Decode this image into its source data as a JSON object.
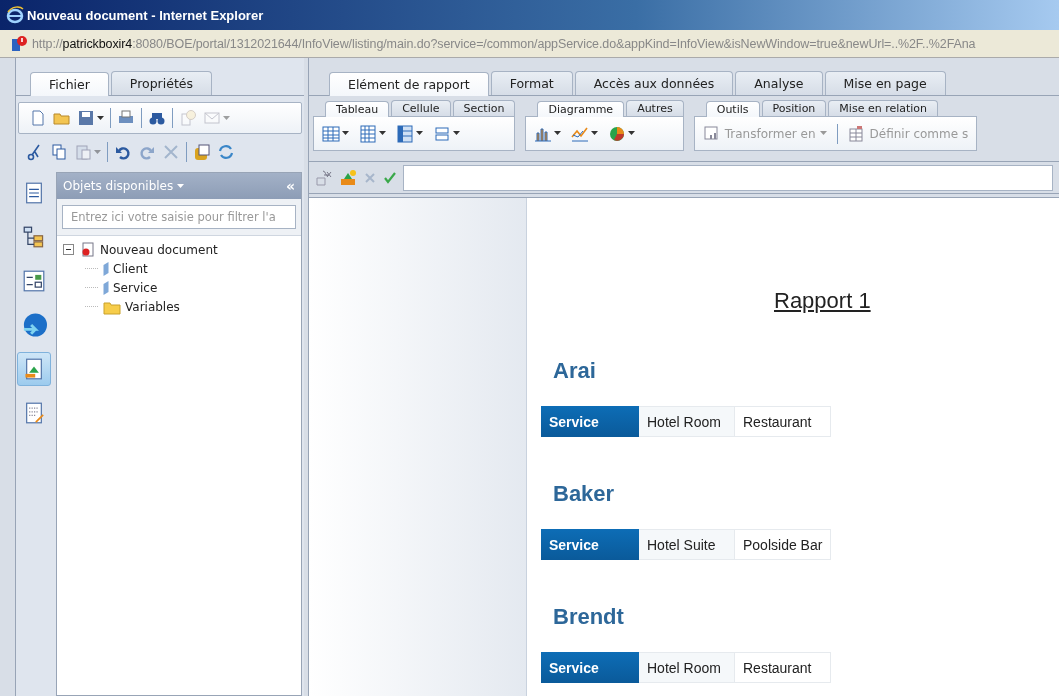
{
  "window": {
    "title": "Nouveau document - Internet Explorer"
  },
  "address": {
    "scheme": "http://",
    "host": "patrickboxir4",
    "rest": ":8080/BOE/portal/1312021644/InfoView/listing/main.do?service=/common/appService.do&appKind=InfoView&isNewWindow=true&newUrl=..%2F..%2FAna"
  },
  "left_tabs": [
    {
      "label": "Fichier",
      "selected": true
    },
    {
      "label": "Propriétés",
      "selected": false
    }
  ],
  "toolbar_1": [
    {
      "kind": "button",
      "disabled": false,
      "dropdown": false
    },
    {
      "kind": "button",
      "disabled": false,
      "dropdown": false
    },
    {
      "kind": "button",
      "disabled": false,
      "dropdown": true
    },
    {
      "kind": "separator"
    },
    {
      "kind": "button",
      "disabled": false,
      "dropdown": false
    },
    {
      "kind": "separator"
    },
    {
      "kind": "button",
      "disabled": false,
      "dropdown": false
    },
    {
      "kind": "separator"
    },
    {
      "kind": "button",
      "disabled": true,
      "dropdown": false
    },
    {
      "kind": "button",
      "disabled": true,
      "dropdown": true
    }
  ],
  "toolbar_2": [
    {
      "kind": "button",
      "disabled": false,
      "dropdown": false
    },
    {
      "kind": "button",
      "disabled": false,
      "dropdown": false
    },
    {
      "kind": "button",
      "disabled": true,
      "dropdown": true
    },
    {
      "kind": "separator"
    },
    {
      "kind": "button",
      "disabled": false,
      "dropdown": false
    },
    {
      "kind": "button",
      "disabled": true,
      "dropdown": false
    },
    {
      "kind": "button",
      "disabled": true,
      "dropdown": false
    },
    {
      "kind": "separator"
    },
    {
      "kind": "button",
      "disabled": false,
      "dropdown": false
    },
    {
      "kind": "button",
      "disabled": false,
      "dropdown": false
    }
  ],
  "side_icons": [
    {
      "selected": false
    },
    {
      "selected": false
    },
    {
      "selected": false
    },
    {
      "selected": false
    },
    {
      "selected": true
    },
    {
      "selected": false
    }
  ],
  "objects_panel": {
    "title": "Objets disponibles",
    "collapse": "«",
    "filter_placeholder": "Entrez ici votre saisie pour filtrer l'a",
    "tree": [
      {
        "label": "Nouveau document",
        "kind": "document",
        "expanded": true,
        "children": [
          {
            "label": "Client",
            "kind": "dimension"
          },
          {
            "label": "Service",
            "kind": "dimension"
          },
          {
            "label": "Variables",
            "kind": "folder"
          }
        ]
      }
    ]
  },
  "main_tabs": [
    {
      "label": "Elément de rapport",
      "selected": true
    },
    {
      "label": "Format",
      "selected": false
    },
    {
      "label": "Accès aux données",
      "selected": false
    },
    {
      "label": "Analyse",
      "selected": false
    },
    {
      "label": "Mise en page",
      "selected": false
    }
  ],
  "ribbon_groups": [
    {
      "tabs": [
        {
          "label": "Tableau",
          "selected": true
        },
        {
          "label": "Cellule",
          "selected": false
        },
        {
          "label": "Section",
          "selected": false
        }
      ],
      "kind": "icons"
    },
    {
      "tabs": [
        {
          "label": "Diagramme",
          "selected": true
        },
        {
          "label": "Autres",
          "selected": false
        }
      ],
      "kind": "charts"
    },
    {
      "tabs": [
        {
          "label": "Outils",
          "selected": true
        },
        {
          "label": "Position",
          "selected": false
        },
        {
          "label": "Mise en relation",
          "selected": false
        }
      ],
      "kind": "tools",
      "buttons": [
        {
          "label": "Transformer en",
          "disabled": true,
          "dropdown": true
        },
        {
          "label": "Définir comme s",
          "disabled": true,
          "dropdown": false
        }
      ]
    }
  ],
  "formula_bar": {
    "cancel_disabled": true
  },
  "report": {
    "title": "Rapport 1",
    "sections": [
      {
        "name": "Arai",
        "cells": [
          "Service",
          "Hotel Room",
          "Restaurant"
        ]
      },
      {
        "name": "Baker",
        "cells": [
          "Service",
          "Hotel Suite",
          "Poolside Bar"
        ]
      },
      {
        "name": "Brendt",
        "cells": [
          "Service",
          "Hotel Room",
          "Restaurant"
        ]
      }
    ]
  }
}
